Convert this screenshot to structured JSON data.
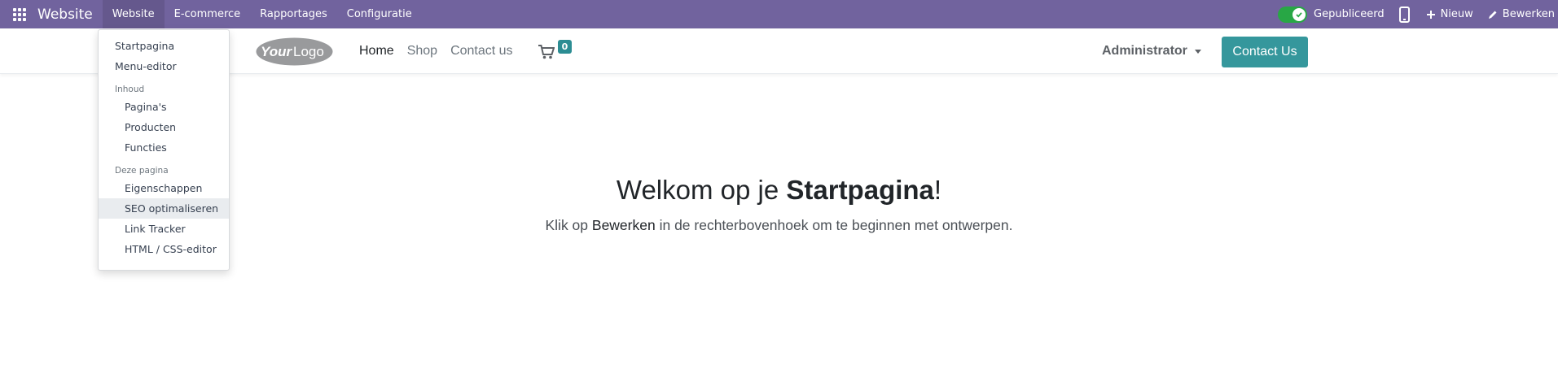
{
  "topbar": {
    "brand": "Website",
    "menus": [
      "Website",
      "E-commerce",
      "Rapportages",
      "Configuratie"
    ],
    "published_label": "Gepubliceerd",
    "new_label": "Nieuw",
    "edit_label": "Bewerken"
  },
  "site": {
    "logo_text": {
      "your": "Your",
      "logo": "Logo"
    },
    "nav": [
      "Home",
      "Shop",
      "Contact us"
    ],
    "cart_count": "0",
    "user_menu": "Administrator",
    "contact_button": "Contact Us"
  },
  "dropdown": {
    "items": {
      "home": "Startpagina",
      "menu_editor": "Menu-editor",
      "content_header": "Inhoud",
      "pages": "Pagina's",
      "products": "Producten",
      "features": "Functies",
      "this_page_header": "Deze pagina",
      "properties": "Eigenschappen",
      "seo": "SEO optimaliseren",
      "link_tracker": "Link Tracker",
      "html_css": "HTML / CSS-editor"
    }
  },
  "hero": {
    "title_prefix": "Welkom op je ",
    "title_bold": "Startpagina",
    "title_suffix": "!",
    "sub_prefix": "Klik op ",
    "sub_bold": "Bewerken",
    "sub_suffix": " in de rechterbovenhoek om te beginnen met ontwerpen."
  },
  "colors": {
    "topbar": "#71639e",
    "accent": "#35979c",
    "toggle_on": "#28a745"
  }
}
